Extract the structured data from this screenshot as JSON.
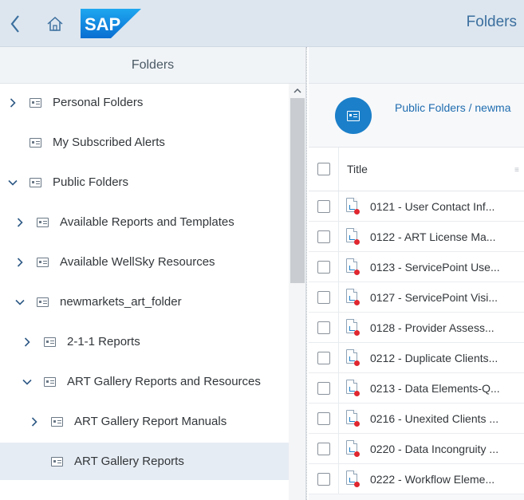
{
  "header": {
    "title": "Folders",
    "logo_text": "SAP",
    "back_icon": "chevron-left-icon",
    "home_icon": "home-icon"
  },
  "left_panel": {
    "title": "Folders",
    "tree": [
      {
        "label": "Personal Folders",
        "toggle": "collapsed",
        "level": 0
      },
      {
        "label": "My Subscribed Alerts",
        "toggle": "none",
        "level": 0
      },
      {
        "label": "Public Folders",
        "toggle": "expanded",
        "level": 0
      },
      {
        "label": "Available Reports and Templates",
        "toggle": "collapsed",
        "level": 1
      },
      {
        "label": "Available WellSky Resources",
        "toggle": "collapsed",
        "level": 1
      },
      {
        "label": "newmarkets_art_folder",
        "toggle": "expanded",
        "level": 1
      },
      {
        "label": "2-1-1 Reports",
        "toggle": "collapsed",
        "level": 2
      },
      {
        "label": "ART Gallery Reports and Resources",
        "toggle": "expanded",
        "level": 2
      },
      {
        "label": "ART Gallery Report Manuals",
        "toggle": "collapsed",
        "level": 3
      },
      {
        "label": "ART Gallery Reports",
        "toggle": "none",
        "level": 3,
        "selected": true
      }
    ]
  },
  "right_panel": {
    "breadcrumb": "Public Folders / newma",
    "table": {
      "column_title": "Title",
      "rows": [
        "0121 - User Contact Inf...",
        "0122 - ART License Ma...",
        "0123 - ServicePoint Use...",
        "0127 - ServicePoint Visi...",
        "0128 - Provider Assess...",
        "0212 - Duplicate Clients...",
        "0213 - Data Elements-Q...",
        "0216 - Unexited Clients ...",
        "0220 - Data Incongruity ...",
        "0222 - Workflow Eleme..."
      ]
    }
  },
  "colors": {
    "header_bg": "#dde6ef",
    "accent": "#1b7fc9",
    "selected_row": "#e6ecf3",
    "doc_marker": "#e0262f"
  }
}
